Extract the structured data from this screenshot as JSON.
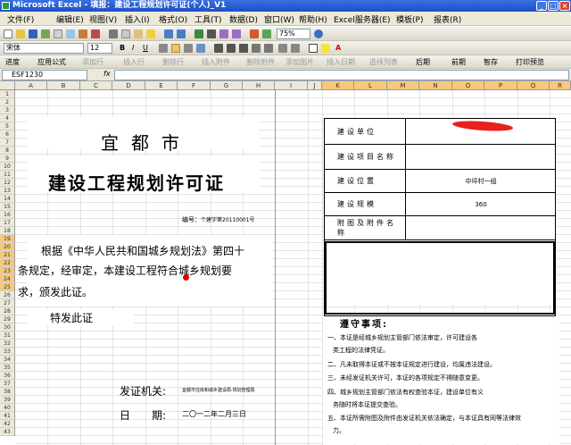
{
  "window": {
    "title": "Microsoft Excel - 填报：建设工程规划许可证(个人)_V1"
  },
  "menu": [
    "文件(F)",
    "编辑(E)",
    "视图(V)",
    "插入(I)",
    "格式(O)",
    "工具(T)",
    "数据(D)",
    "窗口(W)",
    "帮助(H)",
    "Excel服务器(E)",
    "模板(P)",
    "报表(R)"
  ],
  "font": {
    "name": "宋体",
    "size": "12",
    "zoom": "75%"
  },
  "toolbar3": [
    "进度",
    "应用公式",
    "添加行",
    "插入行",
    "删除行",
    "插入附件",
    "删除附件",
    "添加图片",
    "插入日期",
    "选择列表",
    "后期",
    "前期",
    "智存",
    "打印预览"
  ],
  "namebox": "ESF1230",
  "fx": "fx",
  "columns": [
    "A",
    "B",
    "C",
    "D",
    "E",
    "F",
    "G",
    "H",
    "I",
    "J",
    "K",
    "L",
    "M",
    "N",
    "O",
    "P",
    "Q",
    "R"
  ],
  "rows": [
    "1",
    "2",
    "3",
    "4",
    "5",
    "6",
    "7",
    "8",
    "9",
    "10",
    "11",
    "12",
    "13",
    "14",
    "15",
    "16",
    "17",
    "18",
    "19",
    "20",
    "21",
    "22",
    "23",
    "24",
    "25",
    "26",
    "27",
    "28",
    "29",
    "30",
    "31",
    "32",
    "33",
    "34",
    "35",
    "36",
    "37",
    "38",
    "39",
    "40",
    "41",
    "42",
    "43"
  ],
  "certificate": {
    "city": "宜都市",
    "title": "建设工程规划许可证",
    "number_label": "编号：",
    "number": "个建字第20110001号",
    "para1": "根据《中华人民共和国城乡规划法》第四十",
    "para2": "条规定，经审定，本建设工程符合城乡规划要",
    "para3": "求，颁发此证。",
    "issued": "特发此证",
    "authority_label": "发证机关:",
    "authority_value": "宜都市住房和城乡建设局·规划管理局",
    "date_label": "日　　期:",
    "date_value": "二〇一二年二月三日"
  },
  "table": {
    "rows": [
      {
        "label": "建设单位",
        "value": ""
      },
      {
        "label": "建设项目名称",
        "value": ""
      },
      {
        "label": "建设位置",
        "value": "中坪村一组"
      },
      {
        "label": "建设规模",
        "value": "360"
      },
      {
        "label": "附图及附件名称",
        "value": ""
      }
    ]
  },
  "notes": {
    "title": "遵守事项:",
    "items": [
      "一、本证是经城乡规划主管部门依法审定，许可建设各",
      "类工程的法律凭证。",
      "二、凡未取得本证或不按本证规定进行建设，均属违法建设。",
      "三、未经发证机关许可，本证的各项规定不得随意变更。",
      "四、城乡规划主管部门依法有权查验本证，建设单位有义",
      "务随时将本证提交查验。",
      "五、本证所需附图及附件由发证机关依法确定，与本证具有同等法律效",
      "力。"
    ]
  }
}
